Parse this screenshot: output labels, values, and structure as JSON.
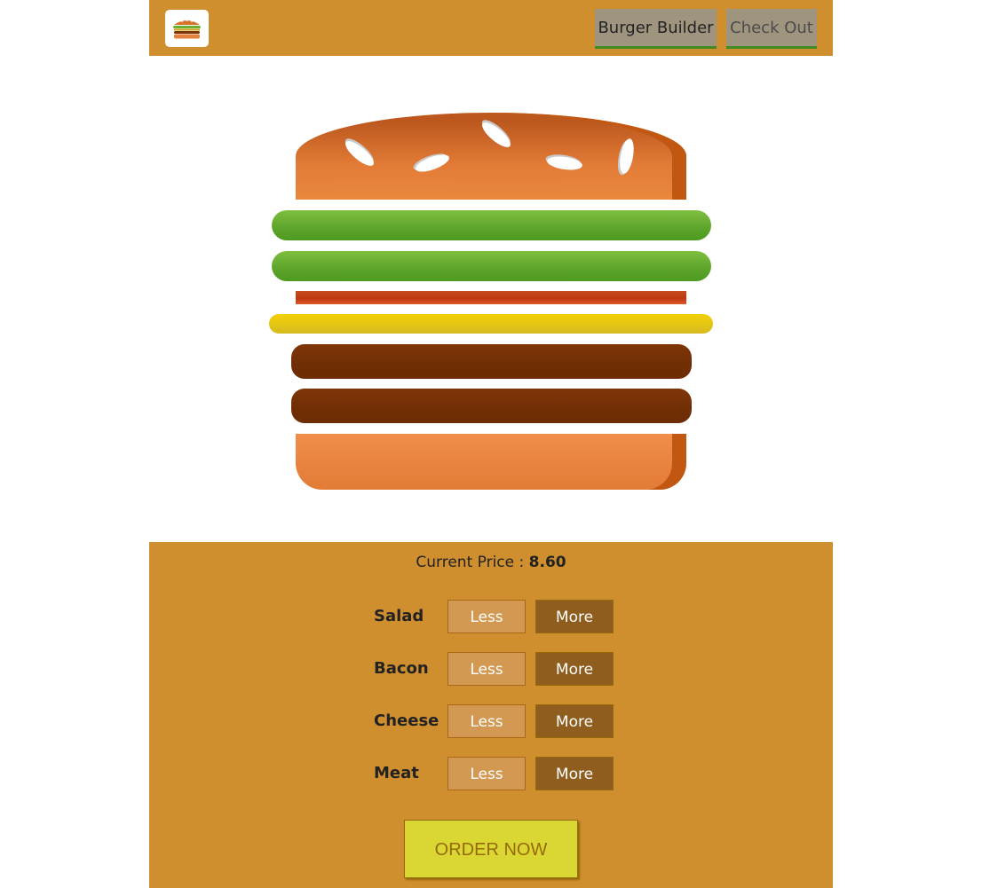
{
  "nav": {
    "logo_icon": "burger-logo-icon",
    "items": [
      {
        "label": "Burger Builder",
        "active": true
      },
      {
        "label": "Check Out",
        "active": false
      }
    ]
  },
  "burger": {
    "layers": [
      "bread-top",
      "salad",
      "salad",
      "bacon",
      "cheese",
      "meat",
      "meat",
      "bread-bottom"
    ]
  },
  "controls": {
    "price_label": "Current Price :",
    "price_value": "8.60",
    "rows": [
      {
        "label": "Salad",
        "less": "Less",
        "more": "More"
      },
      {
        "label": "Bacon",
        "less": "Less",
        "more": "More"
      },
      {
        "label": "Cheese",
        "less": "Less",
        "more": "More"
      },
      {
        "label": "Meat",
        "less": "Less",
        "more": "More"
      }
    ],
    "order_label": "ORDER NOW"
  },
  "colors": {
    "toolbar": "#cf8f2e",
    "controls_bg": "#cf8f2e",
    "less_button": "#d39952",
    "more_button": "#8f5e1e",
    "order_button": "#dad735",
    "order_text": "#966909"
  }
}
